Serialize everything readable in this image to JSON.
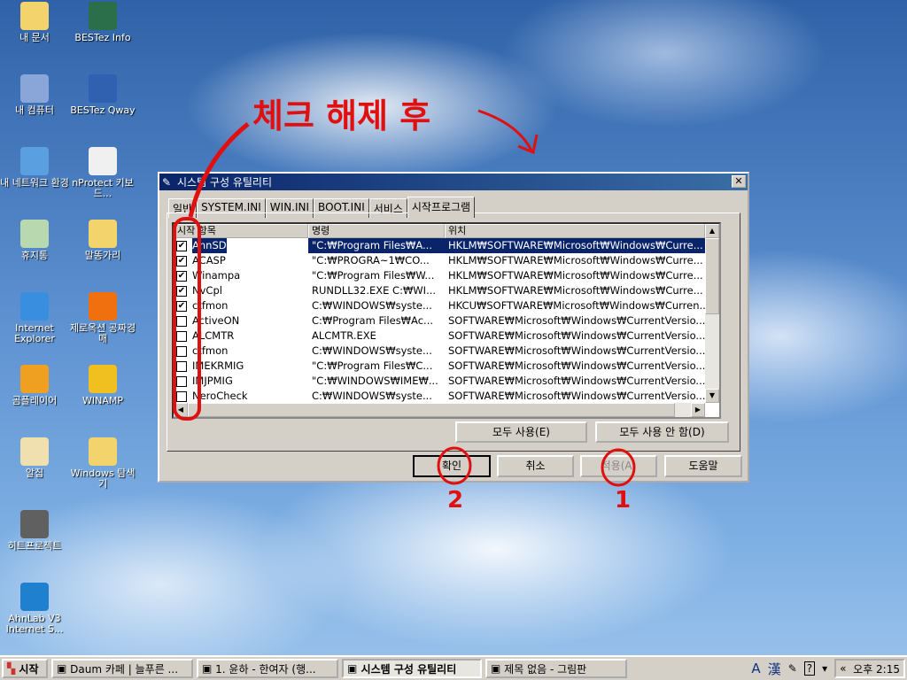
{
  "desktop_icons": [
    {
      "label": "내 문서",
      "icon": "folder-icon"
    },
    {
      "label": "BESTez Info",
      "icon": "info-icon"
    },
    {
      "label": "내 컴퓨터",
      "icon": "computer-icon"
    },
    {
      "label": "BESTez Qway",
      "icon": "qway-icon"
    },
    {
      "label": "내 네트워크 환경",
      "icon": "network-icon"
    },
    {
      "label": "nProtect 키보드...",
      "icon": "keyboard-icon"
    },
    {
      "label": "휴지통",
      "icon": "recycle-bin-icon"
    },
    {
      "label": "말똥가리",
      "icon": "folder-icon"
    },
    {
      "label": "Internet Explorer",
      "icon": "ie-icon"
    },
    {
      "label": "제로옥션 공짜경매",
      "icon": "zero-auction-icon"
    },
    {
      "label": "곰플레이어",
      "icon": "gom-player-icon"
    },
    {
      "label": "WINAMP",
      "icon": "winamp-icon"
    },
    {
      "label": "알집",
      "icon": "alzip-icon"
    },
    {
      "label": "Windows 탐색기",
      "icon": "explorer-icon"
    },
    {
      "label": "히트프로젝트",
      "icon": "hit-project-icon"
    },
    {
      "label": "",
      "icon": ""
    },
    {
      "label": "AhnLab V3 Internet S...",
      "icon": "v3-icon"
    }
  ],
  "dialog": {
    "title": "시스템 구성 유틸리티",
    "tabs": [
      "일반",
      "SYSTEM.INI",
      "WIN.INI",
      "BOOT.INI",
      "서비스",
      "시작프로그램"
    ],
    "active_tab": "시작프로그램",
    "columns": [
      "시작 항목",
      "명령",
      "위치"
    ],
    "rows": [
      {
        "name": "AhnSD",
        "cmd": "\"C:₩Program Files₩A...",
        "loc": "HKLM₩SOFTWARE₩Microsoft₩Windows₩Curre...",
        "checked": true
      },
      {
        "name": "ACASP",
        "cmd": "\"C:₩PROGRA~1₩CO...",
        "loc": "HKLM₩SOFTWARE₩Microsoft₩Windows₩Curre...",
        "checked": true
      },
      {
        "name": "Winampa",
        "cmd": "\"C:₩Program Files₩W...",
        "loc": "HKLM₩SOFTWARE₩Microsoft₩Windows₩Curre...",
        "checked": true
      },
      {
        "name": "NvCpl",
        "cmd": "RUNDLL32.EXE C:₩WI...",
        "loc": "HKLM₩SOFTWARE₩Microsoft₩Windows₩Curre...",
        "checked": true
      },
      {
        "name": "ctfmon",
        "cmd": "C:₩WINDOWS₩syste...",
        "loc": "HKCU₩SOFTWARE₩Microsoft₩Windows₩Curren...",
        "checked": true
      },
      {
        "name": "ActiveON",
        "cmd": "C:₩Program Files₩Ac...",
        "loc": "SOFTWARE₩Microsoft₩Windows₩CurrentVersio...",
        "checked": false
      },
      {
        "name": "ALCMTR",
        "cmd": "ALCMTR.EXE",
        "loc": "SOFTWARE₩Microsoft₩Windows₩CurrentVersio...",
        "checked": false
      },
      {
        "name": "ctfmon",
        "cmd": "C:₩WINDOWS₩syste...",
        "loc": "SOFTWARE₩Microsoft₩Windows₩CurrentVersio...",
        "checked": false
      },
      {
        "name": "IMEKRMIG",
        "cmd": "\"C:₩Program Files₩C...",
        "loc": "SOFTWARE₩Microsoft₩Windows₩CurrentVersio...",
        "checked": false
      },
      {
        "name": "IMJPMIG",
        "cmd": "\"C:₩WINDOWS₩IME₩...",
        "loc": "SOFTWARE₩Microsoft₩Windows₩CurrentVersio...",
        "checked": false
      },
      {
        "name": "NeroCheck",
        "cmd": "C:₩WINDOWS₩syste...",
        "loc": "SOFTWARE₩Microsoft₩Windows₩CurrentVersio...",
        "checked": false
      }
    ],
    "enable_all": "모두 사용(E)",
    "disable_all": "모두 사용 안 함(D)",
    "ok": "확인",
    "cancel": "취소",
    "apply": "적용(A)",
    "help": "도움말"
  },
  "annotations": {
    "main": "체크 해제 후",
    "mark_ok": "2",
    "mark_apply": "1"
  },
  "taskbar": {
    "start": "시작",
    "items": [
      "Daum 카페 | 늘푸른 ...",
      "1. 윤하 - 한여자 (행...",
      "시스템 구성 유틸리티",
      "제목 없음 - 그림판"
    ],
    "active": 2,
    "ime": "A",
    "hanja": "漢",
    "clock": "오후 2:15"
  }
}
